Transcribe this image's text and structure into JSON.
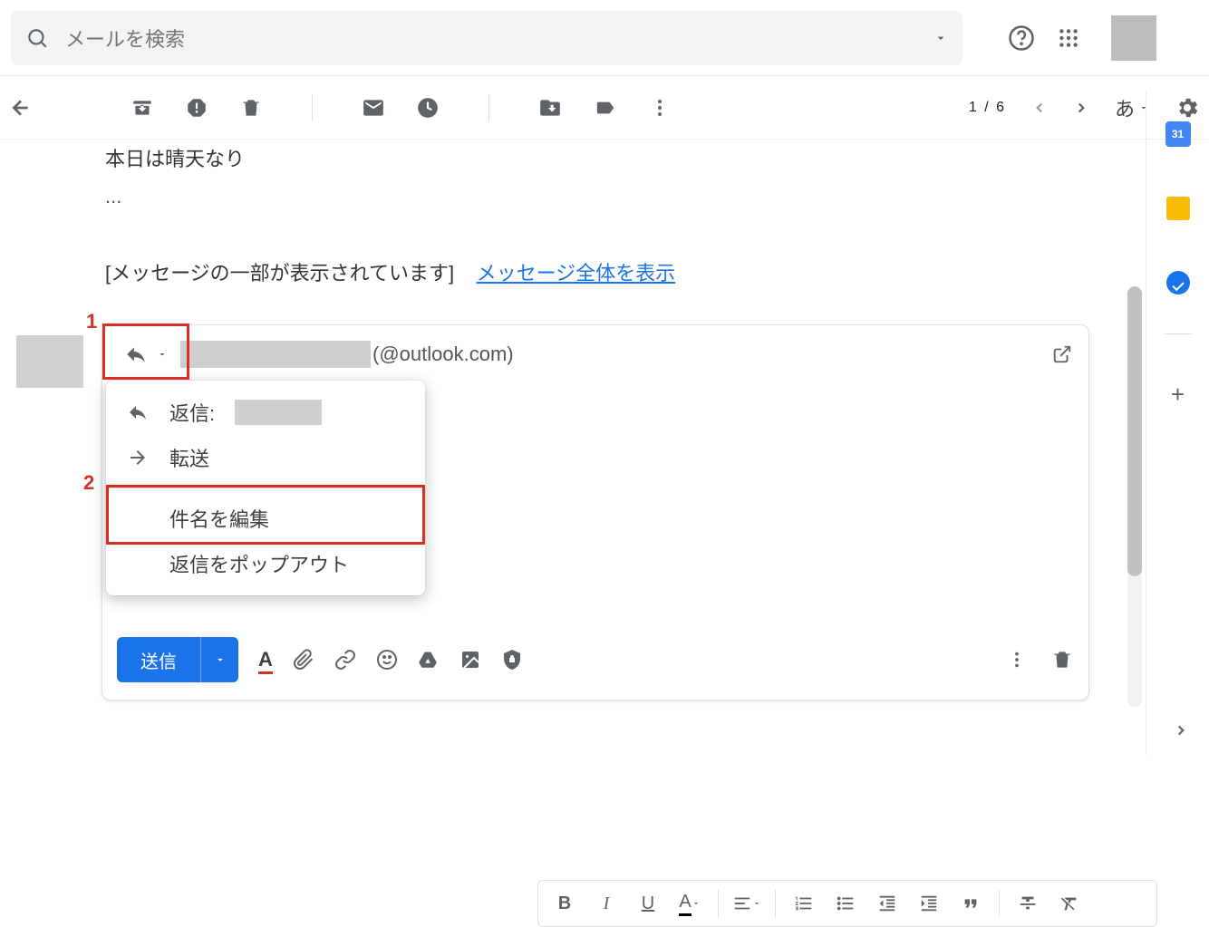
{
  "search": {
    "placeholder": "メールを検索"
  },
  "pagination": {
    "counter": "1 / 6"
  },
  "lang_indicator": "あ",
  "mail": {
    "line1": "本日は晴天なり",
    "ellipsis": "...",
    "clipped_notice": "[メッセージの一部が表示されています]",
    "clipped_link": "メッセージ全体を表示"
  },
  "reply": {
    "recipient_domain": "(@outlook.com)"
  },
  "menu": {
    "reply_label": "返信:",
    "forward_label": "転送",
    "edit_subject_label": "件名を編集",
    "popout_reply_label": "返信をポップアウト"
  },
  "send": {
    "label": "送信"
  },
  "annotations": {
    "one": "1",
    "two": "2"
  },
  "side": {
    "calendar_day": "31"
  }
}
